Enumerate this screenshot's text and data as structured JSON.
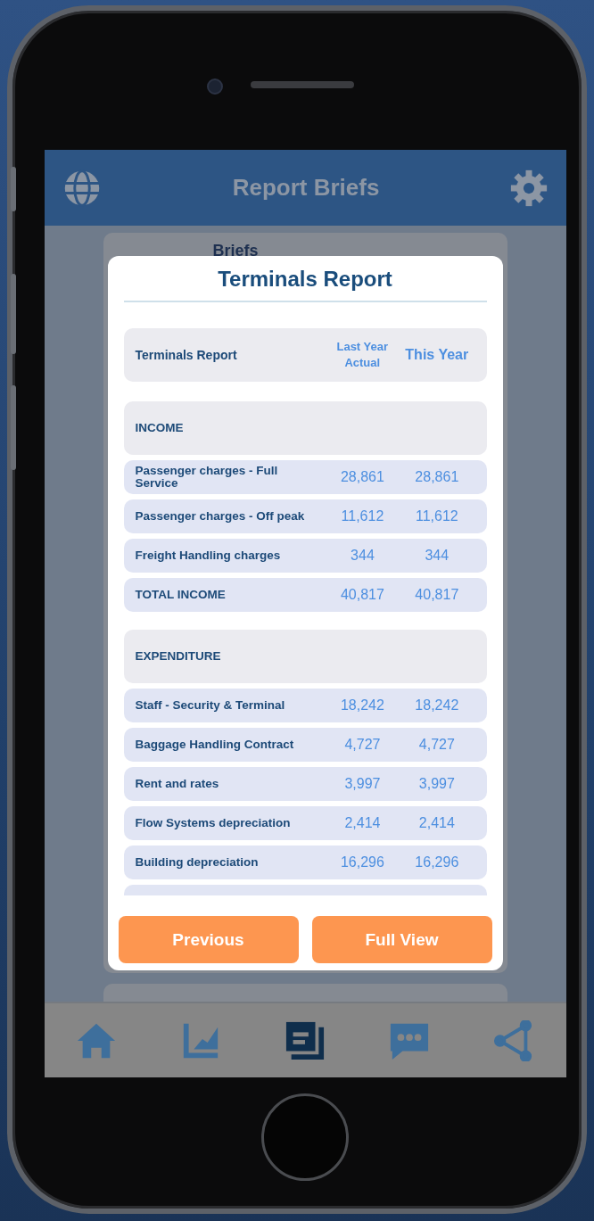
{
  "header": {
    "title": "Report Briefs"
  },
  "background_card": {
    "title": "Briefs"
  },
  "dialog": {
    "title": "Terminals Report",
    "table": {
      "columns": [
        "Terminals Report",
        "Last Year Actual",
        "This Year"
      ],
      "rows": [
        {
          "kind": "section",
          "label": "INCOME"
        },
        {
          "kind": "item",
          "label": "Passenger charges - Full Service",
          "last_year": "28,861",
          "this_year": "28,861"
        },
        {
          "kind": "item",
          "label": "Passenger charges - Off peak",
          "last_year": "11,612",
          "this_year": "11,612"
        },
        {
          "kind": "item",
          "label": "Freight Handling charges",
          "last_year": "344",
          "this_year": "344"
        },
        {
          "kind": "item",
          "label": "TOTAL INCOME",
          "last_year": "40,817",
          "this_year": "40,817"
        },
        {
          "kind": "section",
          "label": "EXPENDITURE"
        },
        {
          "kind": "item",
          "label": "Staff - Security & Terminal",
          "last_year": "18,242",
          "this_year": "18,242"
        },
        {
          "kind": "item",
          "label": "Baggage Handling Contract",
          "last_year": "4,727",
          "this_year": "4,727"
        },
        {
          "kind": "item",
          "label": "Rent and rates",
          "last_year": "3,997",
          "this_year": "3,997"
        },
        {
          "kind": "item",
          "label": "Flow Systems depreciation",
          "last_year": "2,414",
          "this_year": "2,414"
        },
        {
          "kind": "item",
          "label": "Building depreciation",
          "last_year": "16,296",
          "this_year": "16,296"
        }
      ]
    },
    "buttons": [
      "Previous",
      "Full View"
    ]
  },
  "nav": {
    "items": [
      {
        "selected": false
      },
      {
        "selected": false
      },
      {
        "selected": true
      },
      {
        "selected": false
      },
      {
        "selected": false
      }
    ]
  }
}
